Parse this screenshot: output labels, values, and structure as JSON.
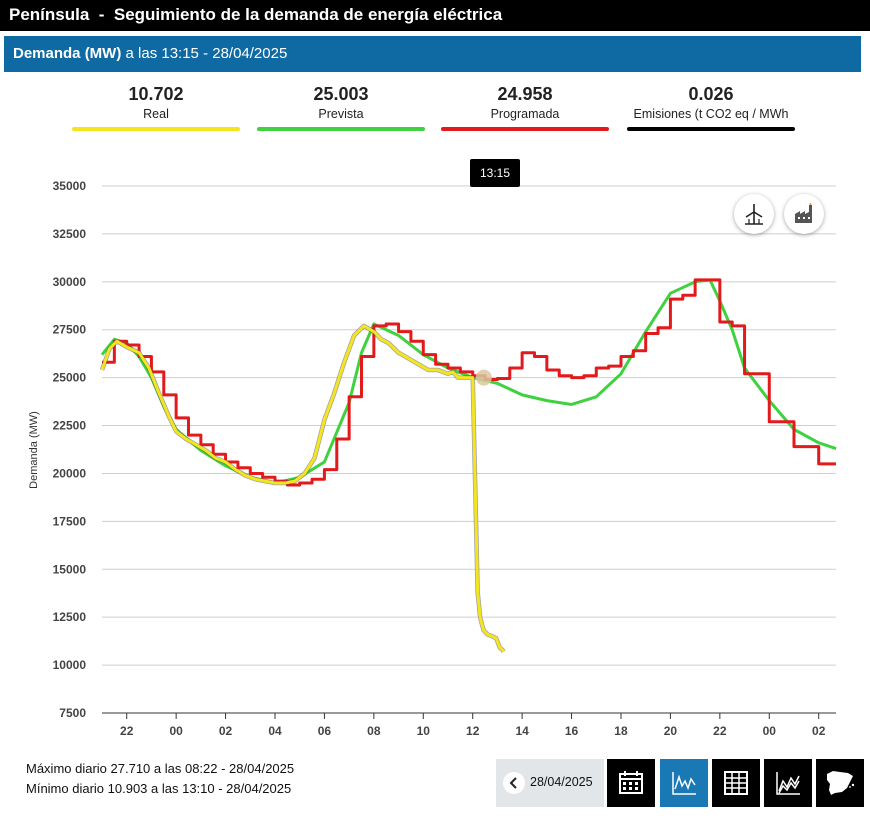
{
  "header": {
    "title": "Península  -  Seguimiento de la demanda de energía eléctrica"
  },
  "subheader": {
    "label_bold": "Demanda (MW)",
    "label_rest": " a las 13:15 - 28/04/2025"
  },
  "stats": [
    {
      "value": "10.702",
      "label": "Real",
      "color": "#f5e51f"
    },
    {
      "value": "25.003",
      "label": "Prevista",
      "color": "#3fd13f"
    },
    {
      "value": "24.958",
      "label": "Programada",
      "color": "#e31a1c"
    },
    {
      "value": "0.026",
      "label": "Emisiones (t CO2 eq / MWh",
      "color": "#000000"
    }
  ],
  "tooltip": {
    "time": "13:15"
  },
  "footer": {
    "max": "Máximo diario 27.710 a las 08:22 - 28/04/2025",
    "min": "Mínimo diario 10.903 a las 13:10 - 28/04/2025",
    "date": "28/04/2025"
  },
  "icons": {
    "renewable": "wind-turbine-icon",
    "factory": "factory-icon",
    "prev": "chevron-left-icon",
    "calendar": "calendar-icon",
    "chart": "line-chart-icon",
    "table": "table-icon",
    "area": "area-chart-icon",
    "map": "spain-map-icon"
  },
  "chart_data": {
    "type": "line",
    "ylabel": "Demanda (MW)",
    "ylim": [
      7500,
      35000
    ],
    "yticks": [
      7500,
      10000,
      12500,
      15000,
      17500,
      20000,
      22500,
      25000,
      27500,
      30000,
      32500,
      35000
    ],
    "xlim": [
      21,
      50.7
    ],
    "xticks": [
      22,
      24,
      26,
      28,
      30,
      32,
      34,
      36,
      38,
      40,
      42,
      44,
      46,
      48,
      50
    ],
    "xticklabels": [
      "22",
      "00",
      "02",
      "04",
      "06",
      "08",
      "10",
      "12",
      "14",
      "16",
      "18",
      "20",
      "22",
      "00",
      "02"
    ],
    "grid": "horizontal",
    "series": [
      {
        "name": "Real",
        "color": "#f5e51f",
        "x": [
          21.0,
          21.3,
          21.6,
          22.0,
          22.5,
          22.9,
          23.3,
          23.7,
          24.0,
          24.4,
          24.8,
          25.2,
          25.6,
          26.0,
          26.4,
          26.8,
          27.2,
          27.6,
          28.0,
          28.4,
          28.8,
          29.2,
          29.6,
          30.0,
          30.4,
          30.8,
          31.2,
          31.6,
          32.0,
          32.3,
          32.6,
          33.0,
          33.4,
          33.8,
          34.2,
          34.6,
          35.0,
          35.2,
          35.4,
          35.7,
          36.0,
          36.2,
          36.3,
          36.4,
          36.45,
          36.6,
          36.8,
          36.95,
          37.1,
          37.2,
          37.25
        ],
        "y": [
          25400,
          26500,
          26900,
          26600,
          26300,
          25500,
          24200,
          23000,
          22200,
          21800,
          21500,
          21200,
          20800,
          20600,
          20200,
          19900,
          19700,
          19600,
          19500,
          19500,
          19600,
          20000,
          20800,
          22800,
          24200,
          25800,
          27200,
          27700,
          27400,
          27000,
          26800,
          26300,
          26000,
          25700,
          25400,
          25400,
          25200,
          25300,
          25000,
          25000,
          25000,
          13800,
          12500,
          12000,
          11800,
          11600,
          11500,
          11400,
          10900,
          10800,
          10702
        ]
      },
      {
        "name": "Prevista",
        "color": "#3fd13f",
        "x": [
          21.0,
          21.5,
          22.0,
          22.5,
          23.0,
          23.5,
          24.0,
          25.0,
          26.0,
          27.0,
          28.0,
          29.0,
          30.0,
          31.0,
          31.5,
          32.0,
          33.0,
          34.0,
          35.0,
          36.0,
          37.0,
          38.0,
          39.0,
          40.0,
          41.0,
          42.0,
          43.0,
          44.0,
          45.0,
          45.6,
          46.0,
          46.5,
          47.0,
          48.0,
          49.0,
          50.0,
          50.7
        ],
        "y": [
          26200,
          27000,
          26800,
          26100,
          25000,
          23500,
          22300,
          21200,
          20400,
          19800,
          19500,
          19800,
          20600,
          23700,
          26300,
          27800,
          27200,
          26200,
          25500,
          25003,
          24700,
          24100,
          23800,
          23600,
          24000,
          25200,
          27400,
          29400,
          30000,
          30100,
          29000,
          27500,
          25500,
          23800,
          22300,
          21600,
          21300
        ]
      },
      {
        "name": "Programada",
        "color": "#e31a1c",
        "x": [
          21.0,
          21.5,
          22.0,
          22.5,
          23.0,
          23.5,
          24.0,
          24.5,
          25.0,
          25.5,
          26.0,
          26.5,
          27.0,
          27.5,
          28.0,
          28.5,
          29.0,
          29.5,
          30.0,
          30.5,
          31.0,
          31.5,
          32.0,
          32.5,
          33.0,
          33.5,
          34.0,
          34.5,
          35.0,
          35.5,
          36.0,
          36.5,
          37.0,
          37.5,
          38.0,
          38.5,
          39.0,
          39.5,
          40.0,
          40.5,
          41.0,
          41.5,
          42.0,
          42.5,
          43.0,
          43.5,
          44.0,
          44.5,
          45.0,
          45.5,
          46.0,
          46.5,
          47.0,
          47.5,
          48.0,
          48.5,
          49.0,
          49.5,
          50.0,
          50.7
        ],
        "y": [
          25800,
          26900,
          26700,
          26100,
          25300,
          24100,
          22900,
          22000,
          21500,
          21000,
          20600,
          20300,
          20000,
          19800,
          19600,
          19400,
          19500,
          19700,
          20200,
          21800,
          24000,
          26100,
          27700,
          27800,
          27400,
          26900,
          26200,
          25700,
          25500,
          25300,
          25100,
          24900,
          24958,
          25500,
          26300,
          26100,
          25400,
          25100,
          25000,
          25100,
          25500,
          25600,
          26100,
          26400,
          27300,
          27600,
          29100,
          29300,
          30100,
          30100,
          27900,
          27700,
          25200,
          25200,
          22700,
          22700,
          21400,
          21400,
          20500,
          20500
        ]
      }
    ]
  }
}
